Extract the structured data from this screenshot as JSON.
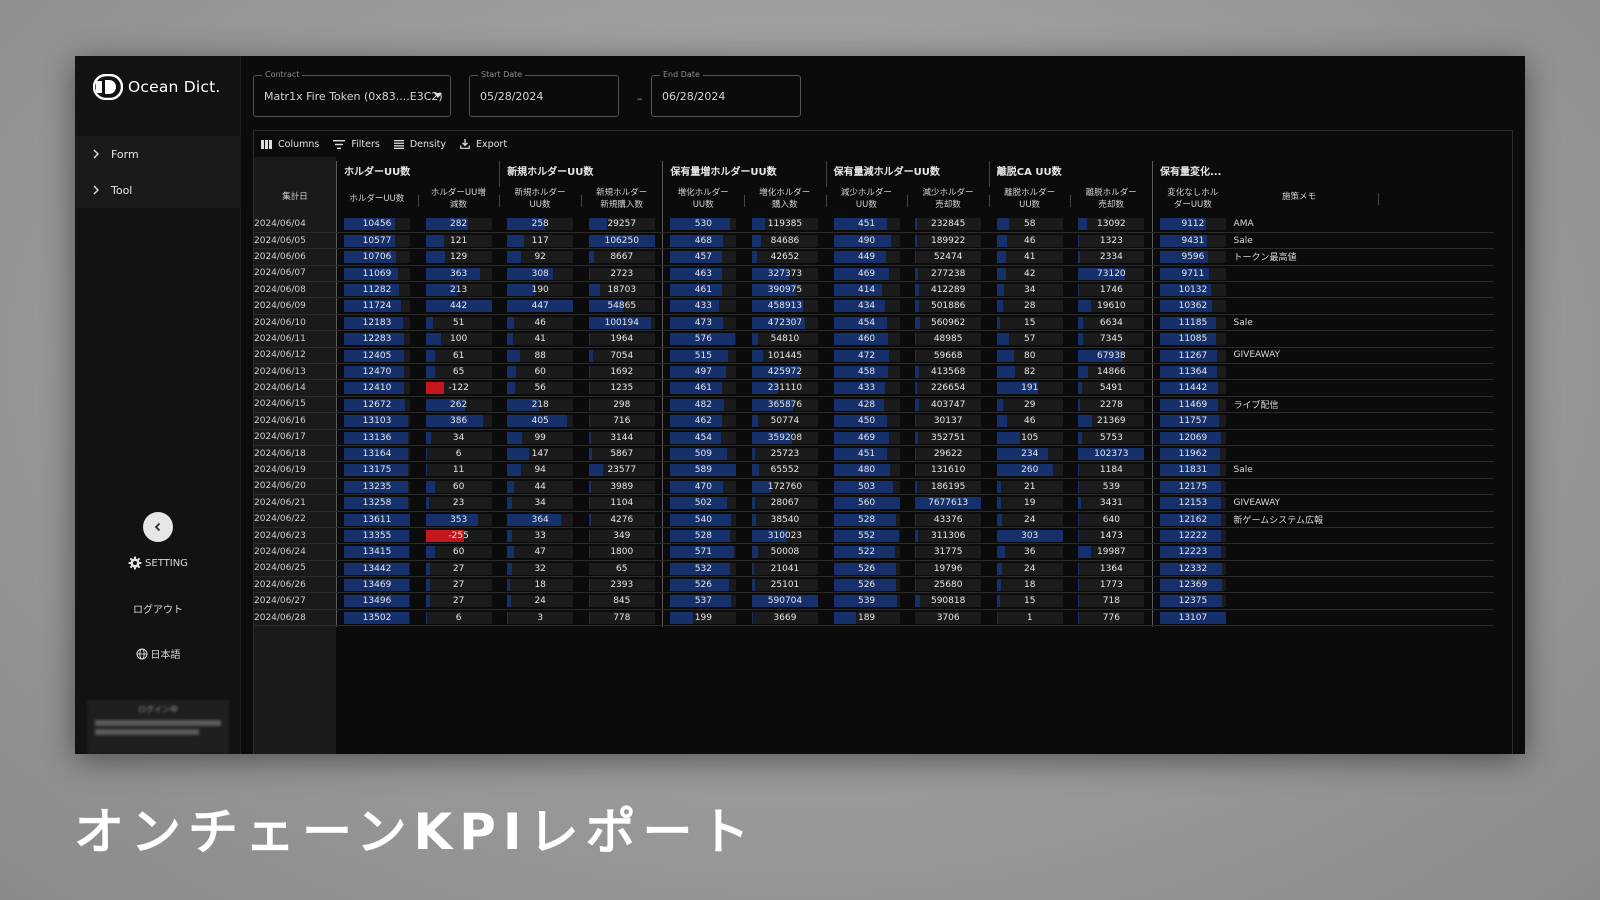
{
  "app": {
    "logo_text": "Ocean Dict."
  },
  "sidebar": {
    "items": [
      {
        "label": "Form"
      },
      {
        "label": "Tool"
      }
    ],
    "setting_label": "SETTING",
    "logout_label": "ログアウト",
    "language_label": "日本語",
    "login_header": "ログイン中"
  },
  "filters": {
    "contract": {
      "label": "Contract",
      "value": "Matr1x Fire Token (0x83....E3C2)"
    },
    "start_date": {
      "label": "Start Date",
      "value": "05/28/2024"
    },
    "end_date": {
      "label": "End Date",
      "value": "06/28/2024"
    },
    "range_separator": "–"
  },
  "toolbar": {
    "columns": "Columns",
    "filters": "Filters",
    "density": "Density",
    "export": "Export"
  },
  "grid": {
    "date_header": "集計日",
    "memo_header": "施策メモ",
    "groups": [
      "ホルダーUU数",
      "新規ホルダーUU数",
      "保有量増ホルダーUU数",
      "保有量減ホルダーUU数",
      "離脱CA UU数",
      "保有量変化..."
    ],
    "columns": [
      [
        "ホルダーUU数"
      ],
      [
        "ホルダーUU増",
        "減数"
      ],
      [
        "新規ホルダー",
        "UU数"
      ],
      [
        "新規ホルダー",
        "新規購入数"
      ],
      [
        "増化ホルダー",
        "UU数"
      ],
      [
        "増化ホルダー",
        "購入数"
      ],
      [
        "減少ホルダー",
        "UU数"
      ],
      [
        "減少ホルダー",
        "売却数"
      ],
      [
        "離脱ホルダー",
        "UU数"
      ],
      [
        "離脱ホルダー",
        "売却数"
      ],
      [
        "変化なしホル",
        "ダーUU数"
      ]
    ],
    "rows": [
      {
        "date": "2024/06/04",
        "values": [
          10456,
          282,
          258,
          29257,
          530,
          119385,
          451,
          232845,
          58,
          13092,
          9112
        ],
        "memo": "AMA"
      },
      {
        "date": "2024/06/05",
        "values": [
          10577,
          121,
          117,
          106250,
          468,
          84686,
          490,
          189922,
          46,
          1323,
          9431
        ],
        "memo": "Sale"
      },
      {
        "date": "2024/06/06",
        "values": [
          10706,
          129,
          92,
          8667,
          457,
          42652,
          449,
          52474,
          41,
          2334,
          9596
        ],
        "memo": "トークン最高値"
      },
      {
        "date": "2024/06/07",
        "values": [
          11069,
          363,
          308,
          2723,
          463,
          327373,
          469,
          277238,
          42,
          73120,
          9711
        ],
        "memo": ""
      },
      {
        "date": "2024/06/08",
        "values": [
          11282,
          213,
          190,
          18703,
          461,
          390975,
          414,
          412289,
          34,
          1746,
          10132
        ],
        "memo": ""
      },
      {
        "date": "2024/06/09",
        "values": [
          11724,
          442,
          447,
          54865,
          433,
          458913,
          434,
          501886,
          28,
          19610,
          10362
        ],
        "memo": ""
      },
      {
        "date": "2024/06/10",
        "values": [
          12183,
          51,
          46,
          100194,
          473,
          472307,
          454,
          560962,
          15,
          6634,
          11185
        ],
        "memo": "Sale"
      },
      {
        "date": "2024/06/11",
        "values": [
          12283,
          100,
          41,
          1964,
          576,
          54810,
          460,
          48985,
          57,
          7345,
          11085
        ],
        "memo": ""
      },
      {
        "date": "2024/06/12",
        "values": [
          12405,
          61,
          88,
          7054,
          515,
          101445,
          472,
          59668,
          80,
          67938,
          11267
        ],
        "memo": "GIVEAWAY"
      },
      {
        "date": "2024/06/13",
        "values": [
          12470,
          65,
          60,
          1692,
          497,
          425972,
          458,
          413568,
          82,
          14866,
          11364
        ],
        "memo": ""
      },
      {
        "date": "2024/06/14",
        "values": [
          12410,
          -122,
          56,
          1235,
          461,
          231110,
          433,
          226654,
          191,
          5491,
          11442
        ],
        "memo": ""
      },
      {
        "date": "2024/06/15",
        "values": [
          12672,
          262,
          218,
          298,
          482,
          365876,
          428,
          403747,
          29,
          2278,
          11469
        ],
        "memo": "ライブ配信"
      },
      {
        "date": "2024/06/16",
        "values": [
          13103,
          386,
          405,
          716,
          462,
          50774,
          450,
          30137,
          46,
          21369,
          11757
        ],
        "memo": ""
      },
      {
        "date": "2024/06/17",
        "values": [
          13136,
          34,
          99,
          3144,
          454,
          359208,
          469,
          352751,
          105,
          5753,
          12069
        ],
        "memo": ""
      },
      {
        "date": "2024/06/18",
        "values": [
          13164,
          6,
          147,
          5867,
          509,
          25723,
          451,
          29622,
          234,
          102373,
          11962
        ],
        "memo": ""
      },
      {
        "date": "2024/06/19",
        "values": [
          13175,
          11,
          94,
          23577,
          589,
          65552,
          480,
          131610,
          260,
          1184,
          11831
        ],
        "memo": "Sale"
      },
      {
        "date": "2024/06/20",
        "values": [
          13235,
          60,
          44,
          3989,
          470,
          172760,
          503,
          186195,
          21,
          539,
          12175
        ],
        "memo": ""
      },
      {
        "date": "2024/06/21",
        "values": [
          13258,
          23,
          34,
          1104,
          502,
          28067,
          560,
          7677613,
          19,
          3431,
          12153
        ],
        "memo": "GIVEAWAY"
      },
      {
        "date": "2024/06/22",
        "values": [
          13611,
          353,
          364,
          4276,
          540,
          38540,
          528,
          43376,
          24,
          640,
          12162
        ],
        "memo": "新ゲームシステム広報"
      },
      {
        "date": "2024/06/23",
        "values": [
          13355,
          -255,
          33,
          349,
          528,
          310023,
          552,
          311306,
          303,
          1473,
          12222
        ],
        "memo": ""
      },
      {
        "date": "2024/06/24",
        "values": [
          13415,
          60,
          47,
          1800,
          571,
          50008,
          522,
          31775,
          36,
          19987,
          12223
        ],
        "memo": ""
      },
      {
        "date": "2024/06/25",
        "values": [
          13442,
          27,
          32,
          65,
          532,
          21041,
          526,
          19796,
          24,
          1364,
          12332
        ],
        "memo": ""
      },
      {
        "date": "2024/06/26",
        "values": [
          13469,
          27,
          18,
          2393,
          526,
          25101,
          526,
          25680,
          18,
          1773,
          12369
        ],
        "memo": ""
      },
      {
        "date": "2024/06/27",
        "values": [
          13496,
          27,
          24,
          845,
          537,
          590704,
          539,
          590818,
          15,
          718,
          12375
        ],
        "memo": ""
      },
      {
        "date": "2024/06/28",
        "values": [
          13502,
          6,
          3,
          778,
          199,
          3669,
          189,
          3706,
          1,
          776,
          13107
        ],
        "memo": ""
      }
    ]
  },
  "colors": {
    "bar_positive": "#15306a",
    "bar_negative": "#c4161b"
  },
  "caption": "オンチェーンKPIレポート"
}
